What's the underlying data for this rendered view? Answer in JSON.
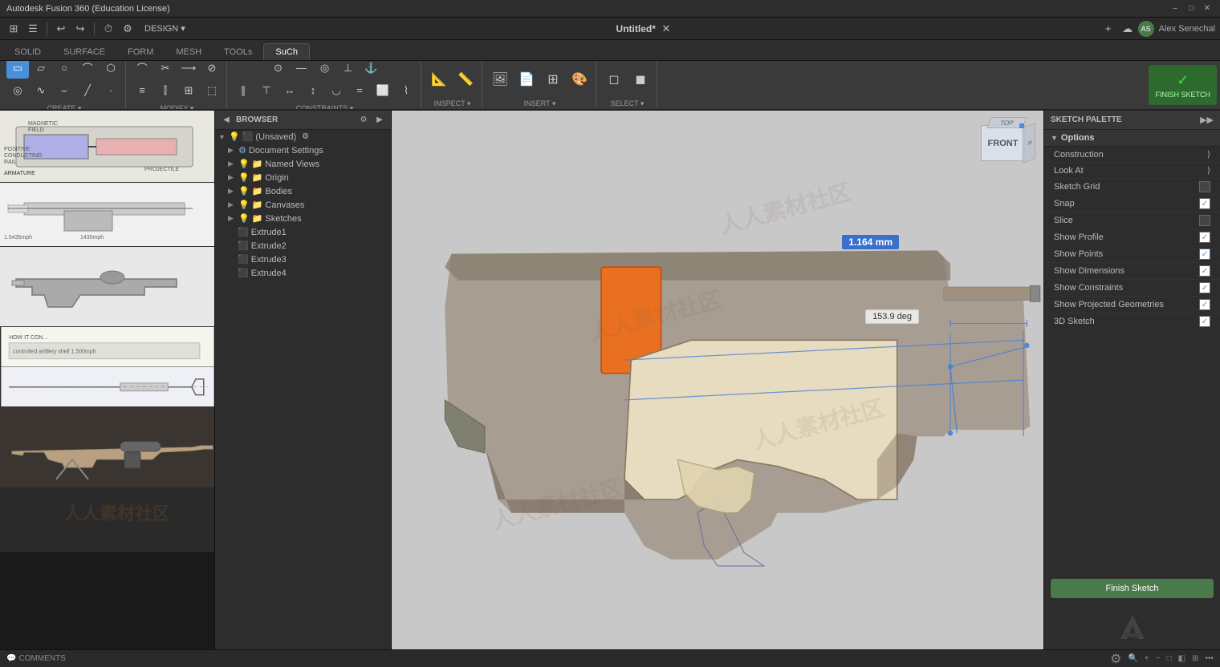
{
  "titlebar": {
    "title": "Autodesk Fusion 360 (Education License)",
    "controls": [
      "–",
      "□",
      "✕"
    ]
  },
  "menubar": {
    "doc_title": "Untitled*",
    "user_name": "Alex Senechal",
    "items": [
      "DESIGN ▾"
    ]
  },
  "tabs": [
    {
      "label": "SOLID",
      "active": false
    },
    {
      "label": "SURFACE",
      "active": false
    },
    {
      "label": "FORM",
      "active": false
    },
    {
      "label": "MESH",
      "active": false
    },
    {
      "label": "TOOLS",
      "active": false
    },
    {
      "label": "SKETCH",
      "active": true
    }
  ],
  "toolbar": {
    "sections": [
      {
        "label": "CREATE ▾",
        "tools": [
          "▭",
          "▱",
          "○",
          "⌒",
          "◎",
          "◇",
          "⬡",
          "✎",
          "⋯"
        ]
      },
      {
        "label": "MODIFY ▾",
        "tools": [
          "⟳",
          "✂",
          "⌖",
          "⊘",
          "—",
          "≡"
        ]
      },
      {
        "label": "CONSTRAINTS ▾",
        "tools": [
          "∥",
          "⊥",
          "≡",
          "△",
          "○",
          "×",
          "⬛",
          "⊤"
        ]
      },
      {
        "label": "INSPECT ▾",
        "tools": [
          "📐",
          "📏"
        ]
      },
      {
        "label": "INSERT ▾",
        "tools": [
          "🖼",
          "⬛",
          "□",
          "▣"
        ]
      },
      {
        "label": "SELECT ▾",
        "tools": [
          "◻",
          "◼"
        ]
      }
    ],
    "finish_sketch_label": "FINISH SKETCH"
  },
  "browser": {
    "title": "BROWSER",
    "items": [
      {
        "label": "(Unsaved)",
        "indent": 0,
        "type": "root",
        "expanded": true
      },
      {
        "label": "Document Settings",
        "indent": 1,
        "type": "settings"
      },
      {
        "label": "Named Views",
        "indent": 1,
        "type": "folder"
      },
      {
        "label": "Origin",
        "indent": 1,
        "type": "folder"
      },
      {
        "label": "Bodies",
        "indent": 1,
        "type": "folder"
      },
      {
        "label": "Canvases",
        "indent": 1,
        "type": "folder"
      },
      {
        "label": "Sketches",
        "indent": 1,
        "type": "folder"
      },
      {
        "label": "Extrude1",
        "indent": 2,
        "type": "extrude"
      },
      {
        "label": "Extrude2",
        "indent": 2,
        "type": "extrude"
      },
      {
        "label": "Extrude3",
        "indent": 2,
        "type": "extrude"
      },
      {
        "label": "Extrude4",
        "indent": 2,
        "type": "extrude"
      }
    ]
  },
  "sketch_palette": {
    "title": "SKETCH PALETTE",
    "options_label": "Options",
    "rows": [
      {
        "label": "Construction",
        "type": "arrow",
        "checked": false
      },
      {
        "label": "Look At",
        "type": "arrow",
        "checked": false
      },
      {
        "label": "Sketch Grid",
        "type": "checkbox",
        "checked": false
      },
      {
        "label": "Snap",
        "type": "checkbox",
        "checked": true
      },
      {
        "label": "Slice",
        "type": "checkbox",
        "checked": false
      },
      {
        "label": "Show Profile",
        "type": "checkbox",
        "checked": true
      },
      {
        "label": "Show Points",
        "type": "checkbox",
        "checked": true
      },
      {
        "label": "Show Dimensions",
        "type": "checkbox",
        "checked": true
      },
      {
        "label": "Show Constraints",
        "type": "checkbox",
        "checked": true
      },
      {
        "label": "Show Projected Geometries",
        "type": "checkbox",
        "checked": true
      },
      {
        "label": "3D Sketch",
        "type": "checkbox",
        "checked": true
      }
    ],
    "finish_button": "Finish Sketch"
  },
  "measurement": {
    "dimension": "1.164 mm",
    "angle": "153.9 deg"
  },
  "bottombar": {
    "comments": "COMMENTS",
    "tools": [
      "⚙",
      "🔍",
      "+",
      "-",
      "□",
      "◧",
      "⊞",
      "..."
    ]
  },
  "view_cube": {
    "face": "FRONT"
  },
  "watermark": "人人素材社区"
}
